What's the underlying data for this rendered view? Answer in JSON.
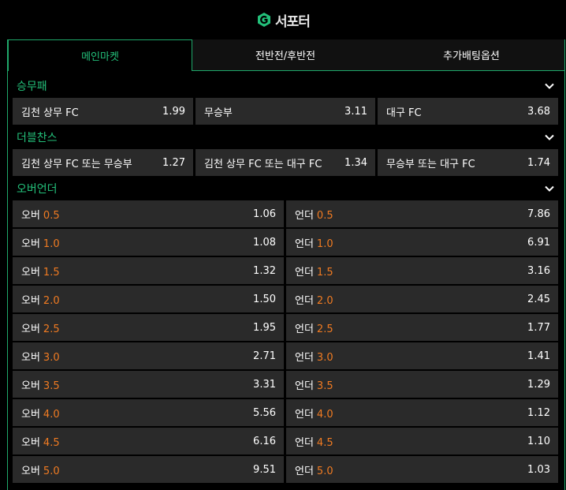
{
  "brand": {
    "name": "서포터"
  },
  "tabs": [
    {
      "label": "메인마켓"
    },
    {
      "label": "전반전/후반전"
    },
    {
      "label": "추가배팅옵션"
    }
  ],
  "sections": {
    "result": {
      "title": "승무패",
      "options": [
        {
          "label": "김천 상무 FC",
          "odds": "1.99"
        },
        {
          "label": "무승부",
          "odds": "3.11"
        },
        {
          "label": "대구 FC",
          "odds": "3.68"
        }
      ]
    },
    "double_chance": {
      "title": "더블찬스",
      "options": [
        {
          "label": "김천 상무 FC 또는 무승부",
          "odds": "1.27"
        },
        {
          "label": "김천 상무 FC 또는 대구 FC",
          "odds": "1.34"
        },
        {
          "label": "무승부 또는 대구 FC",
          "odds": "1.74"
        }
      ]
    },
    "over_under": {
      "title": "오버언더",
      "over_label": "오버",
      "under_label": "언더",
      "rows": [
        {
          "line": "0.5",
          "over": "1.06",
          "under": "7.86"
        },
        {
          "line": "1.0",
          "over": "1.08",
          "under": "6.91"
        },
        {
          "line": "1.5",
          "over": "1.32",
          "under": "3.16"
        },
        {
          "line": "2.0",
          "over": "1.50",
          "under": "2.45"
        },
        {
          "line": "2.5",
          "over": "1.95",
          "under": "1.77"
        },
        {
          "line": "3.0",
          "over": "2.71",
          "under": "1.41"
        },
        {
          "line": "3.5",
          "over": "3.31",
          "under": "1.29"
        },
        {
          "line": "4.0",
          "over": "5.56",
          "under": "1.12"
        },
        {
          "line": "4.5",
          "over": "6.16",
          "under": "1.10"
        },
        {
          "line": "5.0",
          "over": "9.51",
          "under": "1.03"
        }
      ]
    }
  },
  "colors": {
    "accent": "#23c07a",
    "line_highlight": "#f07b22",
    "cell_bg": "#2a2a2a"
  },
  "icons": {
    "logo": "brand-logo-icon",
    "collapse": "chevron-down-icon"
  }
}
